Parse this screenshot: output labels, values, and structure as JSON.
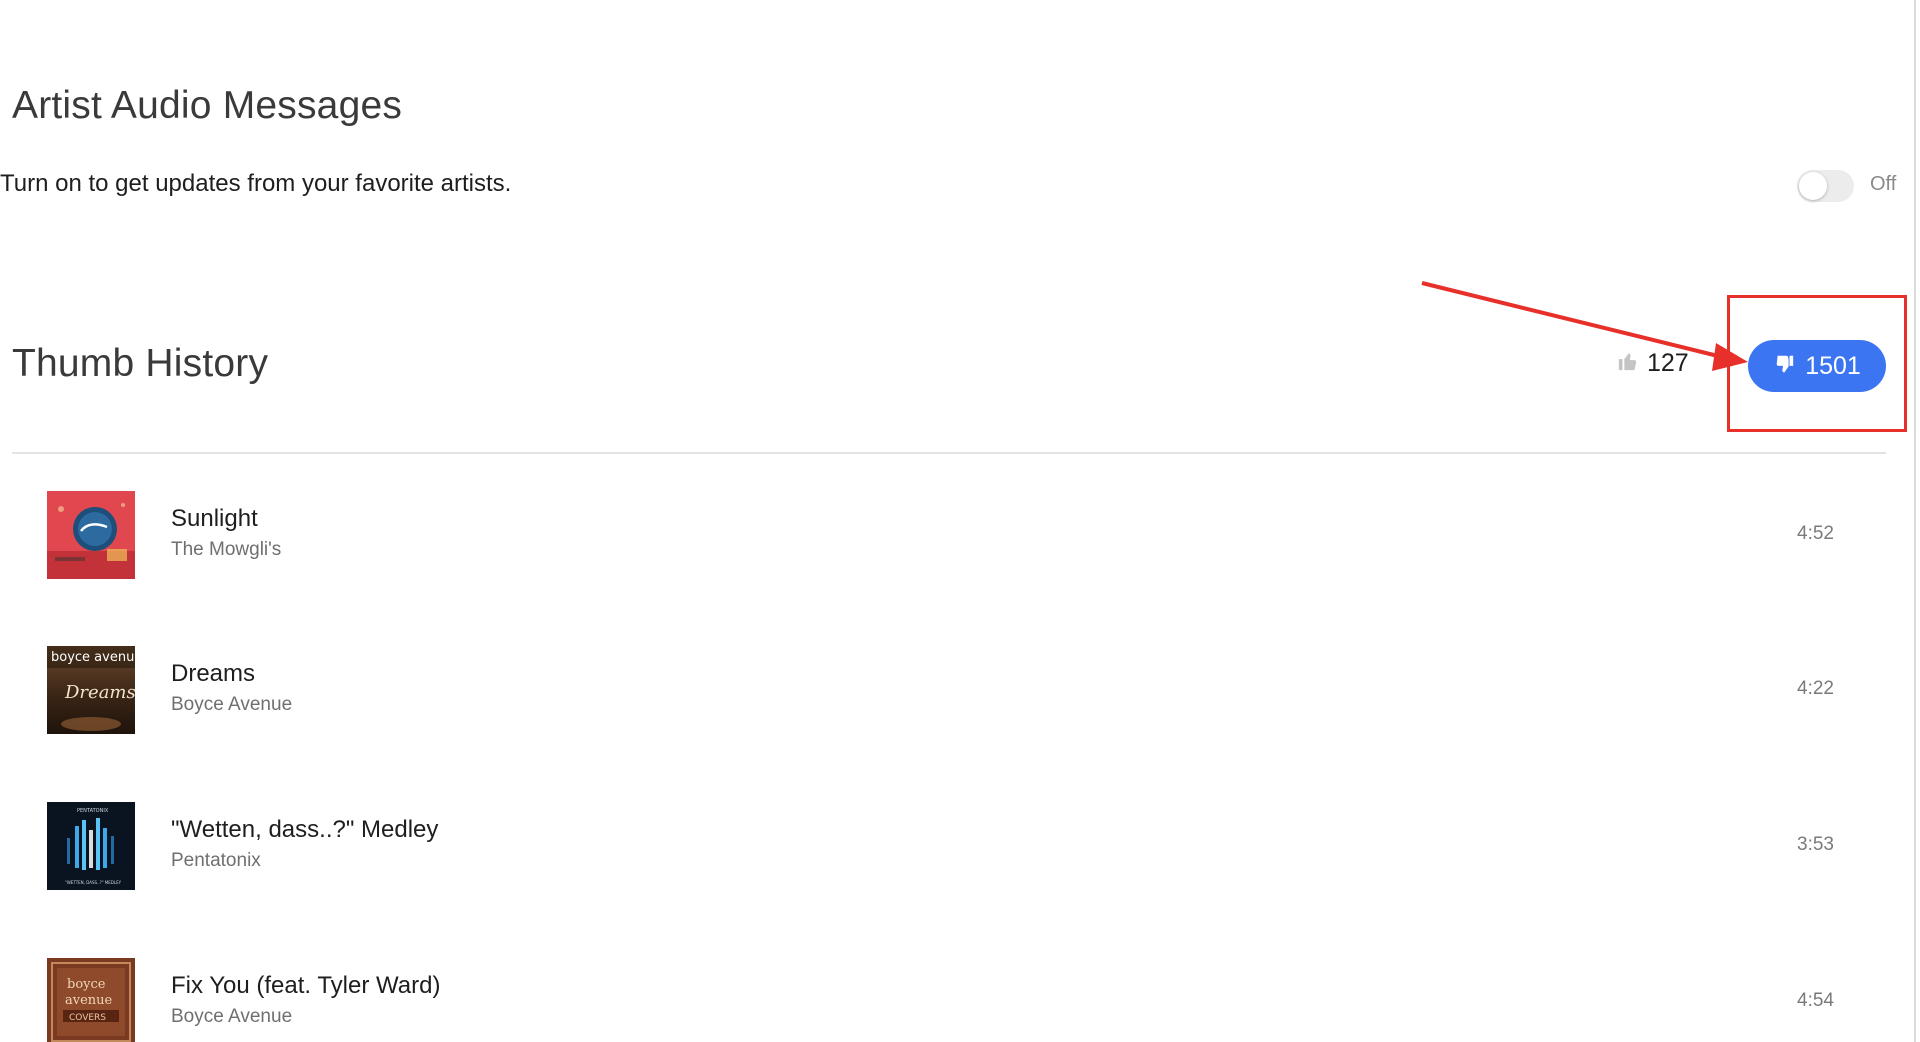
{
  "artist_audio_messages": {
    "title": "Artist Audio Messages",
    "description": "Turn on to get updates from your favorite artists.",
    "toggle_state": "Off"
  },
  "thumb_history": {
    "title": "Thumb History",
    "thumbs_up_count": "127",
    "thumbs_down_count": "1501",
    "accent_color": "#3b75f1",
    "tracks": [
      {
        "title": "Sunlight",
        "artist": "The Mowgli's",
        "duration": "4:52",
        "art_icon": "album-art-sunlight"
      },
      {
        "title": "Dreams",
        "artist": "Boyce Avenue",
        "duration": "4:22",
        "art_icon": "album-art-dreams"
      },
      {
        "title": "\"Wetten, dass..?\" Medley",
        "artist": "Pentatonix",
        "duration": "3:53",
        "art_icon": "album-art-wetten-dass-medley"
      },
      {
        "title": "Fix You (feat. Tyler Ward)",
        "artist": "Boyce Avenue",
        "duration": "4:54",
        "art_icon": "album-art-fix-you"
      }
    ]
  },
  "annotation": {
    "color": "#e8302a"
  }
}
